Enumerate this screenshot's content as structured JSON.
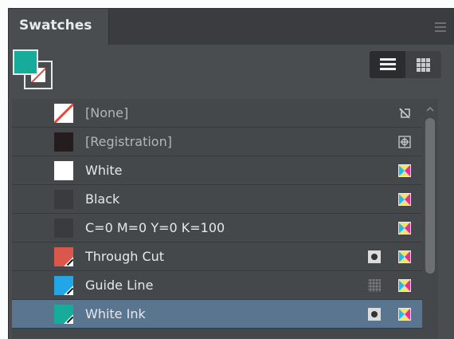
{
  "panel": {
    "tab_label": "Swatches",
    "fill_color": "#17ab9c"
  },
  "view_toggle": {
    "list_icon": "list-view-icon",
    "grid_icon": "grid-view-icon",
    "active": "list"
  },
  "swatches": [
    {
      "name": "[None]",
      "color": "none",
      "kind": "none",
      "dim": true
    },
    {
      "name": "[Registration]",
      "color": "#241c1d",
      "kind": "registration",
      "dim": true
    },
    {
      "name": "White",
      "color": "#ffffff",
      "kind": "process"
    },
    {
      "name": "Black",
      "color": "#3a3b3d",
      "kind": "process"
    },
    {
      "name": "C=0 M=0 Y=0 K=100",
      "color": "#3a3b3d",
      "kind": "process"
    },
    {
      "name": "Through Cut",
      "color": "#d9574b",
      "kind": "spot"
    },
    {
      "name": "Guide Line",
      "color": "#22a6e6",
      "kind": "spot-pattern"
    },
    {
      "name": "White Ink",
      "color": "#17ab9c",
      "kind": "spot",
      "selected": true
    }
  ]
}
